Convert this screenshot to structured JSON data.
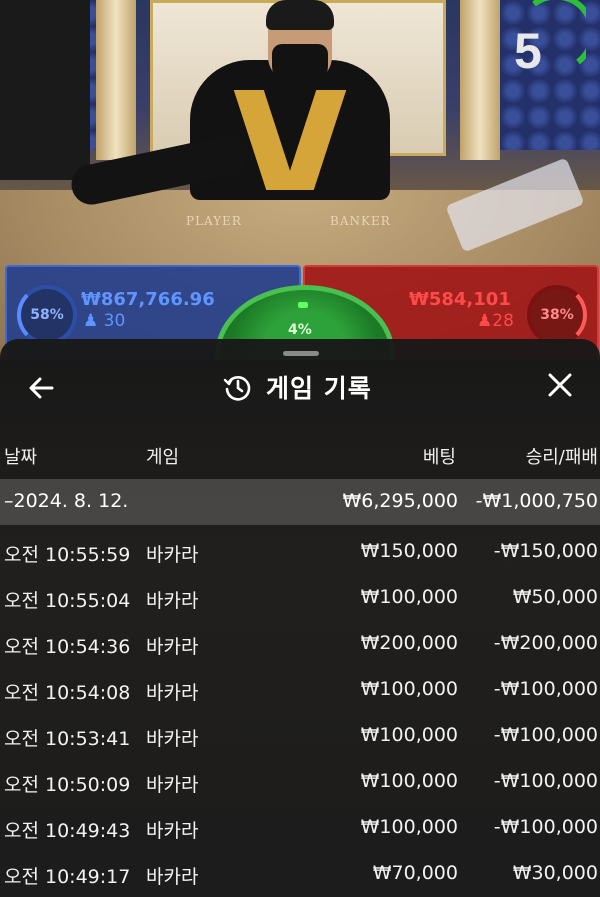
{
  "stream": {
    "countdown": "5",
    "table_labels": {
      "player": "PLAYER",
      "banker": "BANKER"
    }
  },
  "bets": {
    "player": {
      "percent": "58%",
      "amount": "₩867,766.96",
      "players": "30",
      "color": "#5f95ff"
    },
    "tie": {
      "percent": "4%",
      "color": "#2ea23a"
    },
    "banker": {
      "percent": "38%",
      "amount": "₩584,101",
      "players": "28",
      "color": "#ff4a4a"
    }
  },
  "history": {
    "title": "게임 기록",
    "icons": {
      "back": "arrow-left-icon",
      "title": "history-icon",
      "close": "close-icon"
    },
    "columns": {
      "date": "날짜",
      "game": "게임",
      "bet": "베팅",
      "win": "승리/패배"
    },
    "summary": {
      "date": "–2024. 8. 12.",
      "bet": "₩6,295,000",
      "win": "-₩1,000,750"
    },
    "rows": [
      {
        "time": "오전 10:55:59",
        "game": "바카라",
        "bet": "₩150,000",
        "win": "-₩150,000"
      },
      {
        "time": "오전 10:55:04",
        "game": "바카라",
        "bet": "₩100,000",
        "win": "₩50,000"
      },
      {
        "time": "오전 10:54:36",
        "game": "바카라",
        "bet": "₩200,000",
        "win": "-₩200,000"
      },
      {
        "time": "오전 10:54:08",
        "game": "바카라",
        "bet": "₩100,000",
        "win": "-₩100,000"
      },
      {
        "time": "오전 10:53:41",
        "game": "바카라",
        "bet": "₩100,000",
        "win": "-₩100,000"
      },
      {
        "time": "오전 10:50:09",
        "game": "바카라",
        "bet": "₩100,000",
        "win": "-₩100,000"
      },
      {
        "time": "오전 10:49:43",
        "game": "바카라",
        "bet": "₩100,000",
        "win": "-₩100,000"
      },
      {
        "time": "오전 10:49:17",
        "game": "바카라",
        "bet": "₩70,000",
        "win": "₩30,000"
      }
    ]
  }
}
